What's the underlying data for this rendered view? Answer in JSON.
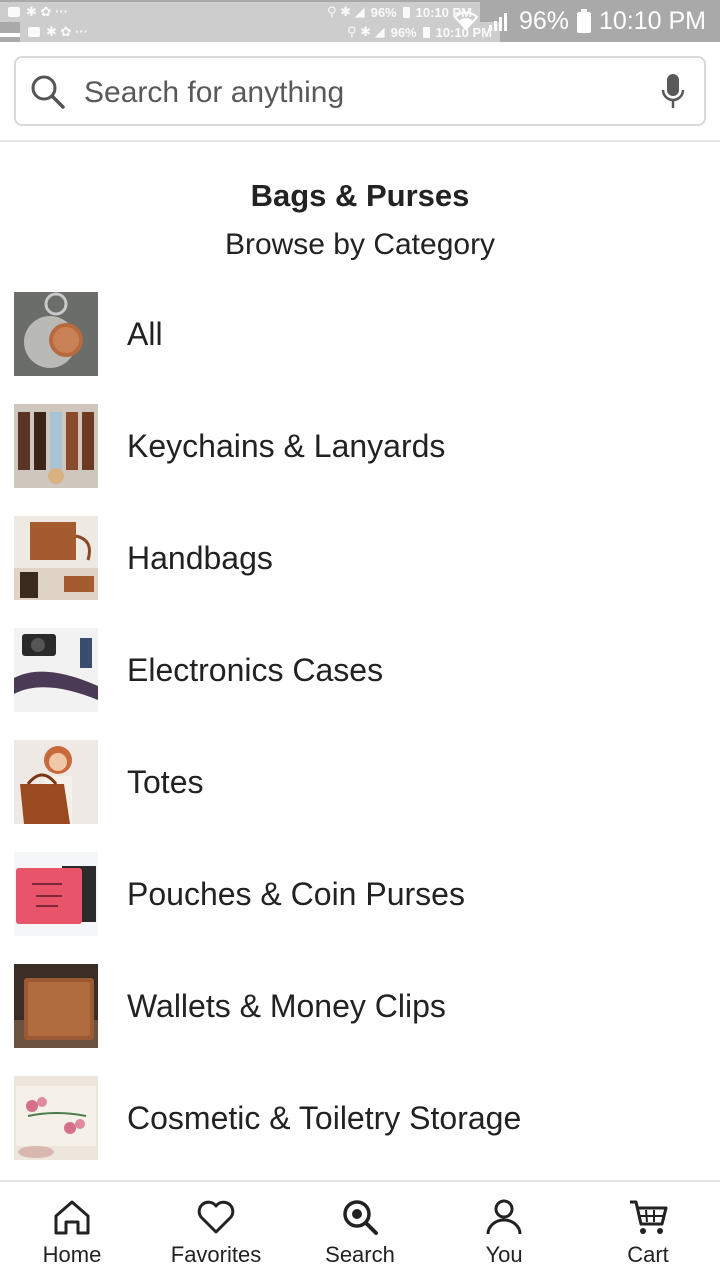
{
  "status_bar": {
    "battery": "96%",
    "time": "10:10 PM",
    "ghost_battery": "96%",
    "ghost_time": "10:10 PM"
  },
  "search": {
    "placeholder": "Search for anything"
  },
  "header": {
    "title": "Bags & Purses",
    "subtitle": "Browse by Category"
  },
  "categories": [
    {
      "label": "All"
    },
    {
      "label": "Keychains & Lanyards"
    },
    {
      "label": "Handbags"
    },
    {
      "label": "Electronics Cases"
    },
    {
      "label": "Totes"
    },
    {
      "label": "Pouches & Coin Purses"
    },
    {
      "label": "Wallets & Money Clips"
    },
    {
      "label": "Cosmetic & Toiletry Storage"
    }
  ],
  "bottom_nav": {
    "items": [
      {
        "label": "Home",
        "icon": "home-icon"
      },
      {
        "label": "Favorites",
        "icon": "heart-icon"
      },
      {
        "label": "Search",
        "icon": "search-icon"
      },
      {
        "label": "You",
        "icon": "person-icon"
      },
      {
        "label": "Cart",
        "icon": "cart-icon"
      }
    ]
  },
  "colors": {
    "status_bar": "#a9a9a9",
    "text": "#222222",
    "border": "#d9d9d9"
  }
}
